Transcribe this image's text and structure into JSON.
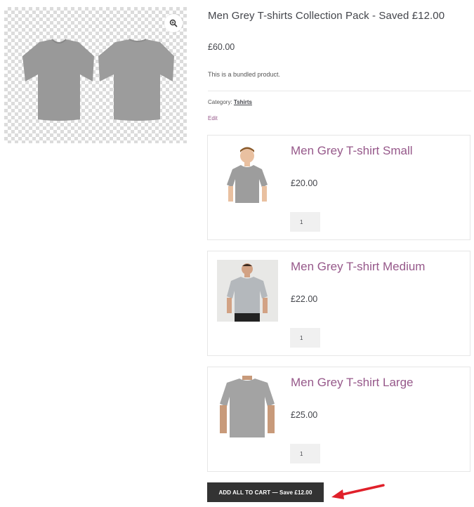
{
  "product": {
    "title": "Men Grey T-shirts Collection Pack - Saved £12.00",
    "price": "£60.00",
    "description": "This is a bundled product.",
    "category_label": "Category:",
    "category_link": "Tshirts",
    "edit_label": "Edit"
  },
  "gallery": {
    "zoom_icon": "magnifier-plus-icon"
  },
  "bundle_items": [
    {
      "name": "Men Grey T-shirt Small",
      "price": "£20.00",
      "quantity": "1"
    },
    {
      "name": "Men Grey T-shirt Medium",
      "price": "£22.00",
      "quantity": "1"
    },
    {
      "name": "Men Grey T-shirt Large",
      "price": "£25.00",
      "quantity": "1"
    }
  ],
  "cart": {
    "button_label": "ADD ALL TO CART — Save £12.00"
  },
  "colors": {
    "accent": "#96588a",
    "button_bg": "#333333",
    "arrow": "#e0202a",
    "shirt": "#9a9a9a"
  }
}
